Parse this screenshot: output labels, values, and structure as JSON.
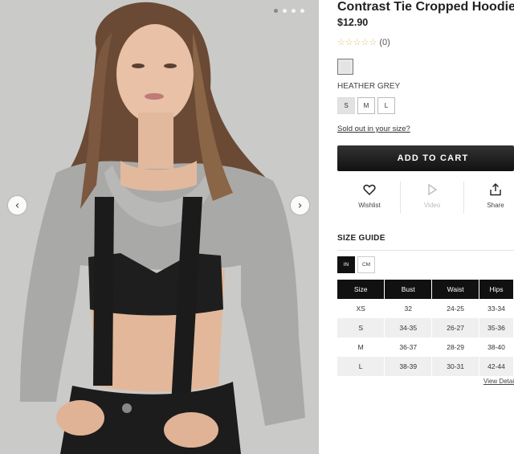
{
  "product": {
    "title": "Contrast Tie Cropped Hoodie",
    "price": "$12.90",
    "stars": "☆☆☆☆☆",
    "review_count": "(0)",
    "color_name": "HEATHER GREY",
    "swatch_color": "#e3e3e3",
    "sizes": [
      "S",
      "M",
      "L"
    ],
    "sold_out_link": "Sold out in your size?",
    "add_to_cart": "ADD TO CART"
  },
  "gallery": {
    "image_count": 4,
    "active_index": 0,
    "prev_icon": "chevron-left-icon",
    "next_icon": "chevron-right-icon"
  },
  "actions": {
    "wishlist": "Wishlist",
    "video": "Video",
    "share": "Share"
  },
  "size_guide": {
    "title": "SIZE GUIDE",
    "units": [
      "IN",
      "CM"
    ],
    "active_unit": "IN",
    "headers": [
      "Size",
      "Bust",
      "Waist",
      "Hips"
    ],
    "rows": [
      [
        "XS",
        "32",
        "24-25",
        "33-34"
      ],
      [
        "S",
        "34-35",
        "26-27",
        "35-36"
      ],
      [
        "M",
        "36-37",
        "28-29",
        "38-40"
      ],
      [
        "L",
        "38-39",
        "30-31",
        "42-44"
      ]
    ],
    "view_details": "View Details"
  },
  "colors": {
    "accent": "#111111",
    "star": "#e2c36c",
    "background_photo": "#c9c9c7"
  }
}
